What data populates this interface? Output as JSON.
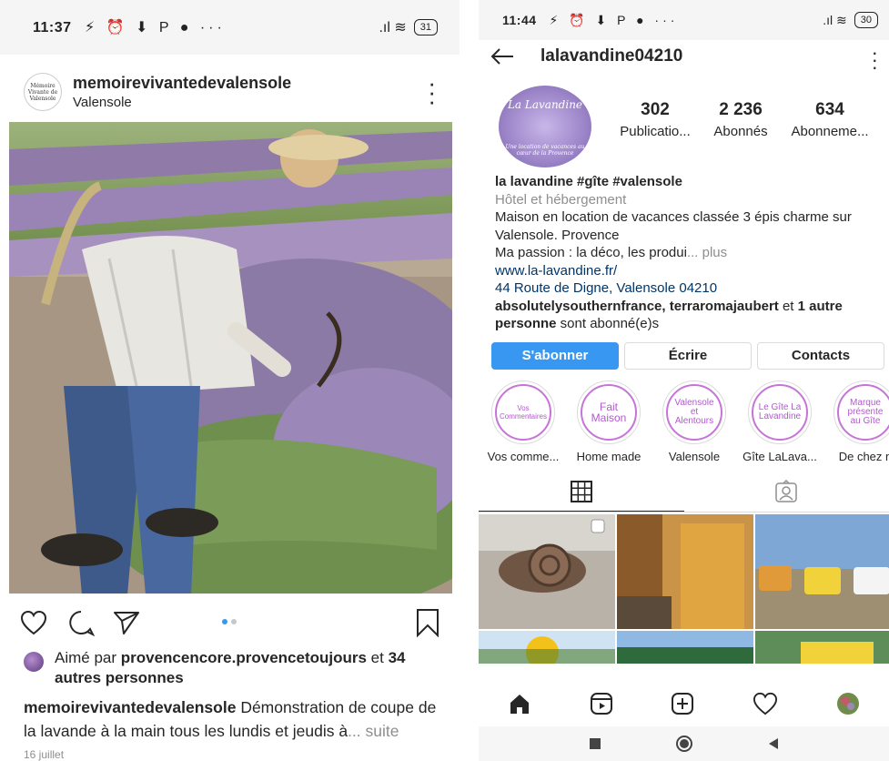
{
  "left": {
    "status": {
      "time": "11:37",
      "icons": "⚡ ⏰ ⬇ P ● ···",
      "signal": ".ıl ≋",
      "battery": "31"
    },
    "post": {
      "username": "memoirevivantedevalensole",
      "location": "Valensole",
      "avatar_text": "Mémoire Vivante de Valensole"
    },
    "likes": {
      "prefix": "Aimé par ",
      "user": "provencencore.provencetoujours",
      "middle": " et ",
      "count": "34",
      "suffix": "autres personnes"
    },
    "caption": {
      "user": "memoirevivantedevalensole",
      "text": " Démonstration de coupe de la lavande à la main tous les lundis et jeudis à",
      "more": "... suite"
    },
    "date": "16 juillet"
  },
  "right": {
    "status": {
      "time": "11:44",
      "icons": "⚡ ⏰ ⬇ P ● ···",
      "signal": ".ıl ≋",
      "battery": "30"
    },
    "profile": {
      "username": "lalavandine04210",
      "avatar_title": "La Lavandine",
      "avatar_sub": "Une location de vacances au cœur de la Provence",
      "stats": [
        {
          "num": "302",
          "label": "Publicatio..."
        },
        {
          "num": "2 236",
          "label": "Abonnés"
        },
        {
          "num": "634",
          "label": "Abonneme..."
        }
      ],
      "bio": {
        "name": "la lavandine #gîte #valensole",
        "category": "Hôtel et hébergement",
        "line1": "Maison en location de vacances classée 3 épis charme sur Valensole. Provence",
        "line2": "Ma passion : la déco, les produi",
        "more": "... plus",
        "website": "www.la-lavandine.fr/",
        "address": "44 Route de Digne, Valensole 04210",
        "followed_by_1": "absolutelysouthernfrance",
        "followed_by_sep": ", ",
        "followed_by_2": "terraromajaubert",
        "followed_by_mid": " et ",
        "followed_by_3": "1 autre personne",
        "followed_by_end": " sont abonné(e)s"
      },
      "buttons": {
        "follow": "S'abonner",
        "message": "Écrire",
        "contacts": "Contacts"
      },
      "highlights": [
        {
          "inner": "Vos Commentaires",
          "caption": "Vos comme..."
        },
        {
          "inner": "Fait Maison",
          "caption": "Home made"
        },
        {
          "inner": "Valensole et Alentours",
          "caption": "Valensole"
        },
        {
          "inner": "Le Gîte La Lavandine",
          "caption": "Gîte LaLava..."
        },
        {
          "inner": "Marque présente au Gîte",
          "caption": "De chez n"
        }
      ]
    }
  },
  "colors": {
    "accent": "#3897f0",
    "lavender": "#b358cf",
    "text": "#262626",
    "muted": "#8e8e8e",
    "link": "#003569"
  }
}
